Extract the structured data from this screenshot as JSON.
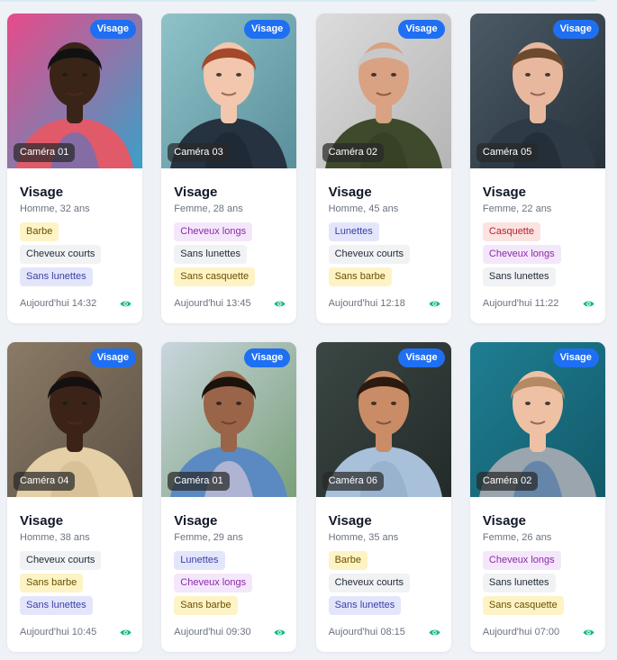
{
  "colors": {
    "type_badge": "#1f6ff2",
    "eye_icon": "#10b981",
    "tag_yellow": "#fdf3c4",
    "tag_gray": "#f1f2f4",
    "tag_indigo": "#e3e6fb",
    "tag_purple": "#f5e7fb",
    "tag_red": "#fde2e2"
  },
  "cards": [
    {
      "type": "Visage",
      "camera": "Caméra 01",
      "title": "Visage",
      "subtitle": "Homme, 32 ans",
      "tags": [
        {
          "label": "Barbe",
          "color": "yellow"
        },
        {
          "label": "Cheveux courts",
          "color": "gray"
        },
        {
          "label": "Sans lunettes",
          "color": "indigo"
        }
      ],
      "time": "Aujourd'hui 14:32",
      "icon": "eye-icon",
      "photo": {
        "bg1": "#e84a8a",
        "bg2": "#3aa0c8",
        "skin": "#3a2418",
        "hair": "#111111",
        "shirt": "#e05a6a",
        "shirt2": "#3a7bd5"
      }
    },
    {
      "type": "Visage",
      "camera": "Caméra 03",
      "title": "Visage",
      "subtitle": "Femme, 28 ans",
      "tags": [
        {
          "label": "Cheveux longs",
          "color": "purple"
        },
        {
          "label": "Sans lunettes",
          "color": "gray"
        },
        {
          "label": "Sans casquette",
          "color": "yellow"
        }
      ],
      "time": "Aujourd'hui 13:45",
      "icon": "eye-icon",
      "photo": {
        "bg1": "#8fc3c9",
        "bg2": "#5a8f9b",
        "skin": "#f2c7ad",
        "hair": "#a4482a",
        "shirt": "#263240",
        "shirt2": "#1b2530"
      }
    },
    {
      "type": "Visage",
      "camera": "Caméra 02",
      "title": "Visage",
      "subtitle": "Homme, 45 ans",
      "tags": [
        {
          "label": "Lunettes",
          "color": "indigo"
        },
        {
          "label": "Cheveux courts",
          "color": "gray"
        },
        {
          "label": "Sans barbe",
          "color": "yellow"
        }
      ],
      "time": "Aujourd'hui 12:18",
      "icon": "eye-icon",
      "photo": {
        "bg1": "#dcdcdc",
        "bg2": "#b5b5b5",
        "skin": "#d9a283",
        "hair": "#c9c9c9",
        "shirt": "#3f4a2c",
        "shirt2": "#323b22"
      }
    },
    {
      "type": "Visage",
      "camera": "Caméra 05",
      "title": "Visage",
      "subtitle": "Femme, 22 ans",
      "tags": [
        {
          "label": "Casquette",
          "color": "red"
        },
        {
          "label": "Cheveux longs",
          "color": "purple"
        },
        {
          "label": "Sans lunettes",
          "color": "gray"
        }
      ],
      "time": "Aujourd'hui 11:22",
      "icon": "eye-icon",
      "photo": {
        "bg1": "#4b5a66",
        "bg2": "#27323b",
        "skin": "#e8b89e",
        "hair": "#6b4a2e",
        "shirt": "#2e3a45",
        "shirt2": "#1e2730"
      }
    },
    {
      "type": "Visage",
      "camera": "Caméra 04",
      "title": "Visage",
      "subtitle": "Homme, 38 ans",
      "tags": [
        {
          "label": "Cheveux courts",
          "color": "gray"
        },
        {
          "label": "Sans barbe",
          "color": "yellow"
        },
        {
          "label": "Sans lunettes",
          "color": "indigo"
        }
      ],
      "time": "Aujourd'hui 10:45",
      "icon": "eye-icon",
      "photo": {
        "bg1": "#8a7a66",
        "bg2": "#5e5245",
        "skin": "#3b2417",
        "hair": "#141010",
        "shirt": "#e4cfa7",
        "shirt2": "#cdb689"
      }
    },
    {
      "type": "Visage",
      "camera": "Caméra 01",
      "title": "Visage",
      "subtitle": "Femme, 29 ans",
      "tags": [
        {
          "label": "Lunettes",
          "color": "indigo"
        },
        {
          "label": "Cheveux longs",
          "color": "purple"
        },
        {
          "label": "Sans barbe",
          "color": "yellow"
        }
      ],
      "time": "Aujourd'hui 09:30",
      "icon": "eye-icon",
      "photo": {
        "bg1": "#c9d6de",
        "bg2": "#7aa07a",
        "skin": "#9a6448",
        "hair": "#1c120c",
        "shirt": "#5b8ac2",
        "shirt2": "#f2d7df"
      }
    },
    {
      "type": "Visage",
      "camera": "Caméra 06",
      "title": "Visage",
      "subtitle": "Homme, 35 ans",
      "tags": [
        {
          "label": "Barbe",
          "color": "yellow"
        },
        {
          "label": "Cheveux courts",
          "color": "gray"
        },
        {
          "label": "Sans lunettes",
          "color": "indigo"
        }
      ],
      "time": "Aujourd'hui 08:15",
      "icon": "eye-icon",
      "photo": {
        "bg1": "#3b4744",
        "bg2": "#232b29",
        "skin": "#c98c66",
        "hair": "#2a1a10",
        "shirt": "#a8c0da",
        "shirt2": "#8ca7c4"
      }
    },
    {
      "type": "Visage",
      "camera": "Caméra 02",
      "title": "Visage",
      "subtitle": "Femme, 26 ans",
      "tags": [
        {
          "label": "Cheveux longs",
          "color": "purple"
        },
        {
          "label": "Sans lunettes",
          "color": "gray"
        },
        {
          "label": "Sans casquette",
          "color": "yellow"
        }
      ],
      "time": "Aujourd'hui 07:00",
      "icon": "eye-icon",
      "photo": {
        "bg1": "#1f7e92",
        "bg2": "#125a6a",
        "skin": "#eec1a4",
        "hair": "#b48a64",
        "shirt": "#9aa5ae",
        "shirt2": "#3d6ea6"
      }
    }
  ]
}
